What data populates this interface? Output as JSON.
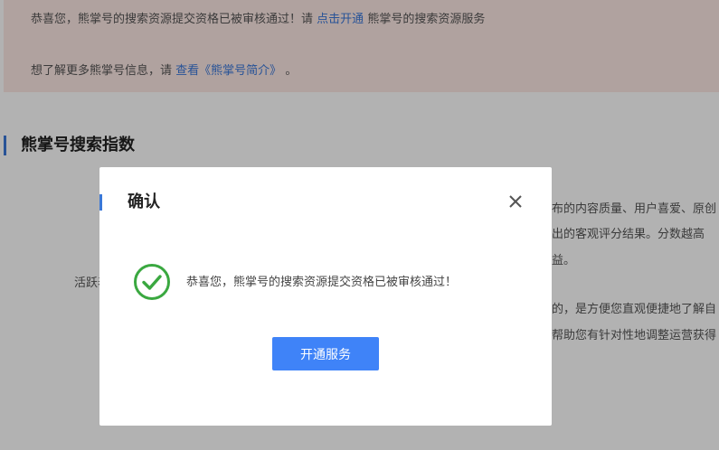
{
  "notice": {
    "line1_prefix": "恭喜您，熊掌号的搜索资源提交资格已被审核通过！请",
    "line1_link": "点击开通",
    "line1_suffix": "熊掌号的搜索资源服务",
    "line2_prefix": "想了解更多熊掌号信息，请",
    "line2_link": "查看《熊掌号简介》",
    "line2_suffix": "。"
  },
  "section": {
    "title": "熊掌号搜索指数"
  },
  "background_text": {
    "r1": "布的内容质量、用户喜爱、原创",
    "r2": "出的客观评分结果。分数越高",
    "r3": "益。",
    "left_label": "活跃表",
    "r4": "的，是方便您直观便捷地了解自",
    "r5": "帮助您有针对性地调整运营获得"
  },
  "modal": {
    "title": "确认",
    "message": "恭喜您，熊掌号的搜索资源提交资格已被审核通过！",
    "primary_button": "开通服务"
  },
  "colors": {
    "accent": "#3a78d8",
    "success": "#3aa840",
    "button": "#3f83f8"
  },
  "icons": {
    "close": "close-icon",
    "success": "check-circle-icon"
  }
}
